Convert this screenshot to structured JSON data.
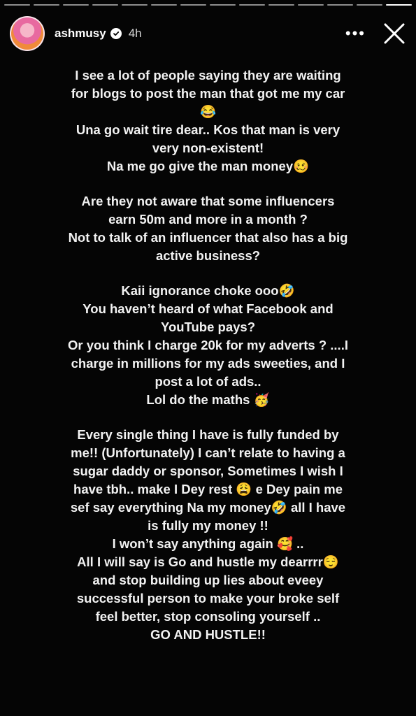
{
  "story_progress": {
    "segments": 14,
    "active_index": 13
  },
  "header": {
    "username": "ashmusy",
    "time": "4h",
    "more_label": "•••",
    "avatar_icon": "avatar-photo",
    "verified_icon": "verified-badge-icon",
    "close_icon": "close-icon"
  },
  "story": {
    "paragraphs": [
      {
        "lines": [
          "I see a lot of people saying they are waiting",
          "for blogs to post the man that got me my car",
          "😂",
          "Una go wait tire dear.. Kos that man is very",
          "very non-existent!",
          "Na me go give the man money🥴"
        ]
      },
      {
        "lines": [
          "Are they not aware that some influencers",
          "earn 50m and more in a month ?",
          "Not to talk of an influencer that also has a big",
          "active business?"
        ]
      },
      {
        "lines": [
          "Kaii ignorance choke ooo🤣",
          "You haven’t heard of what Facebook and",
          "YouTube pays?",
          "Or you think I charge 20k for my adverts ? ....I",
          "charge in millions for my ads sweeties, and I",
          "post a lot of ads..",
          "Lol do the maths 🥳"
        ]
      },
      {
        "lines": [
          "Every single thing I have is fully funded by",
          "me!! (Unfortunately) I can’t relate to having a",
          "sugar daddy or sponsor, Sometimes I wish I",
          "have tbh.. make I Dey rest 😩 e Dey pain me",
          "sef say everything Na my money🤣 all I have",
          "is fully my money !!",
          "I won’t say anything again 🥰 ..",
          "All I will say is Go and hustle my dearrrr😌",
          "and stop building up lies about eveey",
          "successful person to make your broke self",
          "feel better, stop consoling yourself ..",
          "GO AND HUSTLE!!"
        ]
      }
    ]
  }
}
